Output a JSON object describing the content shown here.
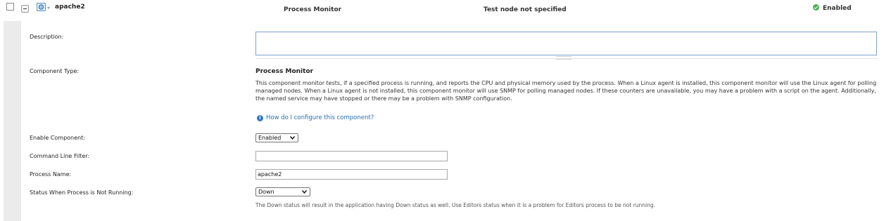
{
  "component": {
    "name": "apache2",
    "type": "Process Monitor",
    "test_node": "Test node not specified",
    "status": "Enabled",
    "status_color": "#4caf50"
  },
  "form": {
    "description_label": "Description:",
    "description_value": "",
    "component_type_label": "Component Type:",
    "component_type_title": "Process Monitor",
    "component_type_desc": "This component monitor tests, if a specified process is running, and reports the CPU and physical memory used by the process. When a Linux agent is installed, this component monitor will use the Linux agent for polling managed nodes. When a Linux agent is not installed, this component monitor will use SNMP for polling managed nodes. If these counters are unavailable, you may have a problem with a script on the agent. Additionally, the named service may have stopped or there may be a problem with SNMP configuration.",
    "help_link": "How do I configure this component?",
    "enable_label": "Enable Component:",
    "enable_value": "Enabled",
    "cmd_filter_label": "Command Line Filter:",
    "cmd_filter_value": "",
    "process_name_label": "Process Name:",
    "process_name_value": "apache2",
    "status_not_running_label": "Status When Process is Not Running:",
    "status_not_running_value": "Down",
    "status_note": "The Down status will result in the application having Down status as well. Use Editors status when it is a problem for Editors process to be not running."
  },
  "icons": {
    "checkbox": "checkbox-icon",
    "collapse": "collapse-icon",
    "component": "process-monitor-icon",
    "status": "check-circle-icon",
    "info": "info-icon",
    "dropdown": "chevron-down-icon"
  }
}
